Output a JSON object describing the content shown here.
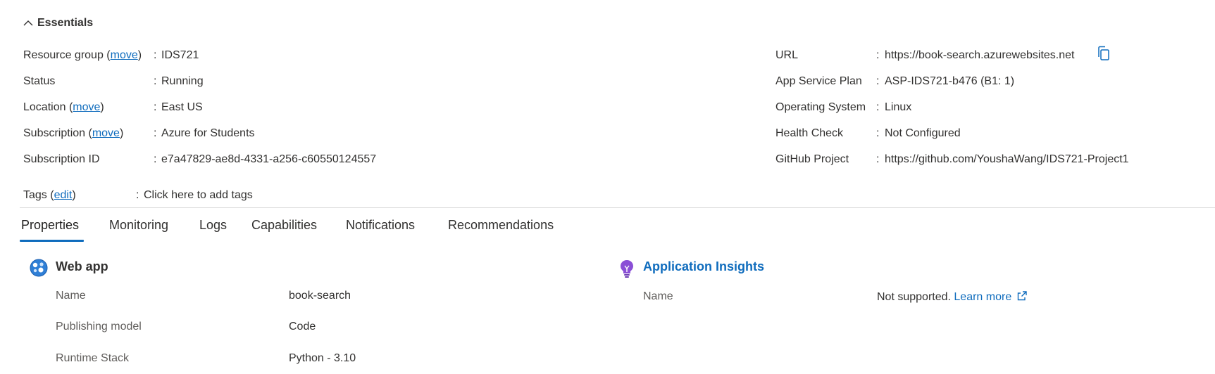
{
  "essentials": {
    "title": "Essentials",
    "left": [
      {
        "label_pre": "Resource group (",
        "label_link": "move",
        "label_post": ")",
        "value": "IDS721",
        "value_is_link": true
      },
      {
        "label_pre": "Status",
        "label_link": "",
        "label_post": "",
        "value": "Running",
        "value_is_link": false
      },
      {
        "label_pre": "Location (",
        "label_link": "move",
        "label_post": ")",
        "value": "East US",
        "value_is_link": false
      },
      {
        "label_pre": "Subscription (",
        "label_link": "move",
        "label_post": ")",
        "value": "Azure for Students",
        "value_is_link": true
      },
      {
        "label_pre": "Subscription ID",
        "label_link": "",
        "label_post": "",
        "value": "e7a47829-ae8d-4331-a256-c60550124557",
        "value_is_link": false
      }
    ],
    "right": [
      {
        "label": "URL",
        "value": "https://book-search.azurewebsites.net",
        "value_is_link": true
      },
      {
        "label": "App Service Plan",
        "value": "ASP-IDS721-b476 (B1: 1)",
        "value_is_link": true
      },
      {
        "label": "Operating System",
        "value": "Linux",
        "value_is_link": false
      },
      {
        "label": "Health Check",
        "value": "Not Configured",
        "value_is_link": true
      },
      {
        "label": "GitHub Project",
        "value": "https://github.com/YoushaWang/IDS721-Project1",
        "value_is_link": true
      }
    ],
    "tags": {
      "label_pre": "Tags (",
      "label_link": "edit",
      "label_post": ")",
      "value": "Click here to add tags"
    },
    "colon": ":"
  },
  "tabs": [
    "Properties",
    "Monitoring",
    "Logs",
    "Capabilities",
    "Notifications",
    "Recommendations"
  ],
  "active_tab": "Properties",
  "web_app": {
    "title": "Web app",
    "rows": [
      {
        "label": "Name",
        "value": "book-search"
      },
      {
        "label": "Publishing model",
        "value": "Code"
      },
      {
        "label": "Runtime Stack",
        "value": "Python - 3.10"
      }
    ]
  },
  "app_insights": {
    "title": "Application Insights",
    "name_label": "Name",
    "name_value": "Not supported.",
    "learn_more": "Learn more"
  },
  "colors": {
    "link": "#0f6cbd",
    "text": "#323130",
    "muted": "#605e5c",
    "accent": "#0f6cbd"
  },
  "icons": {
    "copy": "copy-icon",
    "external": "external-link-icon",
    "web_app": "web-app-icon",
    "insights": "application-insights-icon",
    "chevron": "chevron-up-icon"
  }
}
